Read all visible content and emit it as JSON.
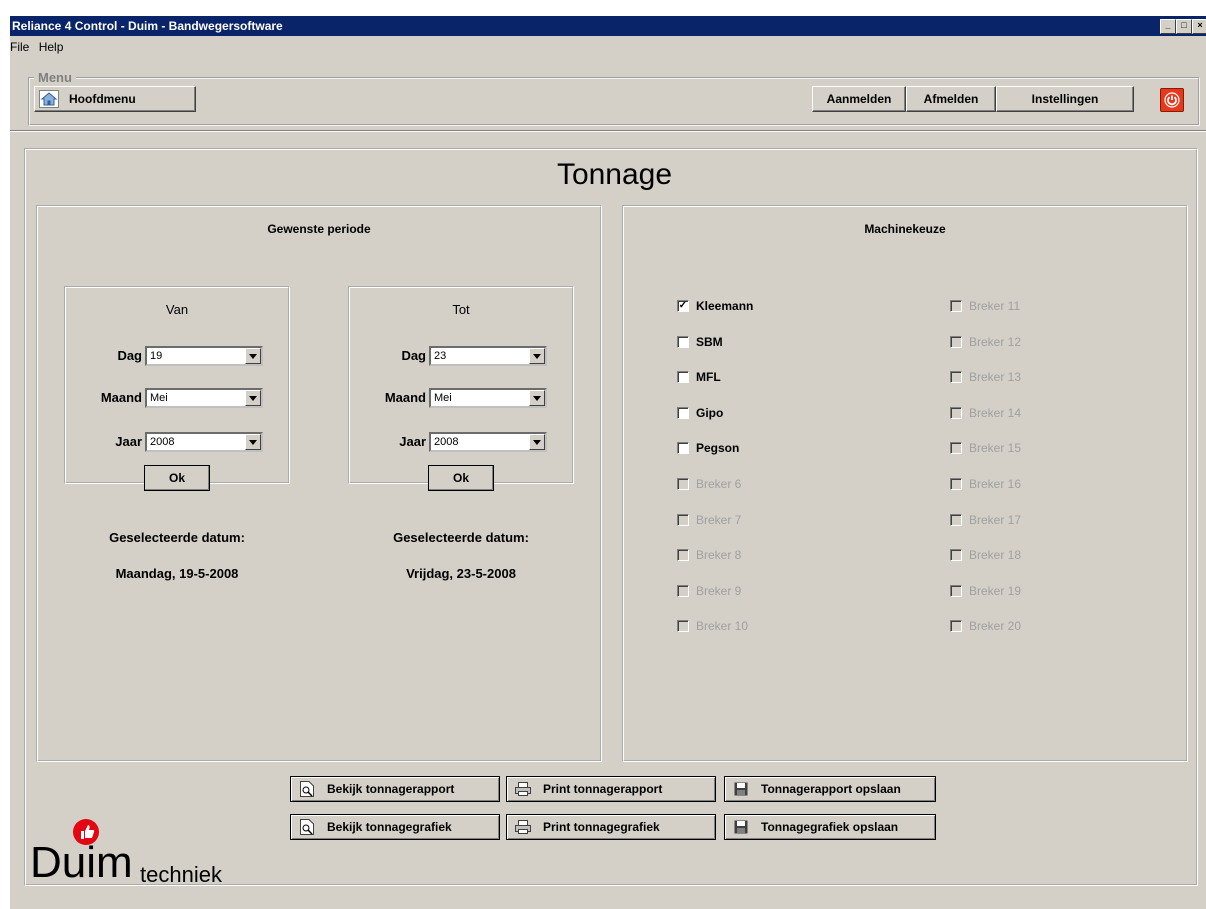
{
  "window": {
    "title": "Reliance 4 Control - Duim - Bandwegersoftware"
  },
  "menubar": {
    "file": "File",
    "help": "Help"
  },
  "menu_group": {
    "legend": "Menu",
    "home_label": "Hoofdmenu",
    "login_label": "Aanmelden",
    "logout_label": "Afmelden",
    "settings_label": "Instellingen"
  },
  "page": {
    "title": "Tonnage"
  },
  "period": {
    "title": "Gewenste periode",
    "from": {
      "title": "Van",
      "day_label": "Dag",
      "day_value": "19",
      "month_label": "Maand",
      "month_value": "Mei",
      "year_label": "Jaar",
      "year_value": "2008",
      "ok_label": "Ok",
      "selected_label": "Geselecteerde datum:",
      "selected_value": "Maandag, 19-5-2008"
    },
    "to": {
      "title": "Tot",
      "day_label": "Dag",
      "day_value": "23",
      "month_label": "Maand",
      "month_value": "Mei",
      "year_label": "Jaar",
      "year_value": "2008",
      "ok_label": "Ok",
      "selected_label": "Geselecteerde datum:",
      "selected_value": "Vrijdag, 23-5-2008"
    }
  },
  "machines": {
    "title": "Machinekeuze",
    "left": [
      {
        "label": "Kleemann",
        "checked": true,
        "enabled": true
      },
      {
        "label": "SBM",
        "checked": false,
        "enabled": true
      },
      {
        "label": "MFL",
        "checked": false,
        "enabled": true
      },
      {
        "label": "Gipo",
        "checked": false,
        "enabled": true
      },
      {
        "label": "Pegson",
        "checked": false,
        "enabled": true
      },
      {
        "label": "Breker 6",
        "checked": false,
        "enabled": false
      },
      {
        "label": "Breker 7",
        "checked": false,
        "enabled": false
      },
      {
        "label": "Breker 8",
        "checked": false,
        "enabled": false
      },
      {
        "label": "Breker 9",
        "checked": false,
        "enabled": false
      },
      {
        "label": "Breker 10",
        "checked": false,
        "enabled": false
      }
    ],
    "right": [
      {
        "label": "Breker 11",
        "checked": false,
        "enabled": false
      },
      {
        "label": "Breker 12",
        "checked": false,
        "enabled": false
      },
      {
        "label": "Breker 13",
        "checked": false,
        "enabled": false
      },
      {
        "label": "Breker 14",
        "checked": false,
        "enabled": false
      },
      {
        "label": "Breker 15",
        "checked": false,
        "enabled": false
      },
      {
        "label": "Breker 16",
        "checked": false,
        "enabled": false
      },
      {
        "label": "Breker 17",
        "checked": false,
        "enabled": false
      },
      {
        "label": "Breker 18",
        "checked": false,
        "enabled": false
      },
      {
        "label": "Breker 19",
        "checked": false,
        "enabled": false
      },
      {
        "label": "Breker 20",
        "checked": false,
        "enabled": false
      }
    ]
  },
  "actions": {
    "view_report": "Bekijk tonnagerapport",
    "print_report": "Print tonnagerapport",
    "save_report": "Tonnagerapport opslaan",
    "view_chart": "Bekijk tonnagegrafiek",
    "print_chart": "Print tonnagegrafiek",
    "save_chart": "Tonnagegrafiek opslaan"
  },
  "logo": {
    "brand": "Duim",
    "sub": "techniek"
  },
  "colors": {
    "titlebar": "#0a246a",
    "face": "#d4d0c8",
    "power": "#e8381c",
    "logo_red": "#e30613"
  }
}
